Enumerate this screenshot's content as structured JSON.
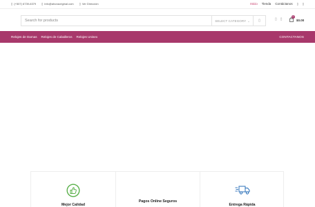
{
  "topbar": {
    "phone": "(+507) 6739-6379",
    "email": "info@ahoraoriginal.com",
    "address": "Ver Dirección",
    "links": {
      "home": "Inicio",
      "shop": "Tienda",
      "contact": "Contáctanos"
    }
  },
  "search": {
    "placeholder": "Search for products",
    "category_label": "SELECT CATEGORY"
  },
  "cart": {
    "count": "0",
    "amount": "$0.00"
  },
  "nav": {
    "items": [
      "Relojes de Damas",
      "Relojes de Caballeros",
      "Relojes Unisex"
    ],
    "contact": "CONTACTANOS"
  },
  "features": [
    {
      "label": "Mejor Calidad",
      "icon": "thumbs-up-icon"
    },
    {
      "label": "Pagos Online Seguros",
      "icon": ""
    },
    {
      "label": "Entrega Rápida",
      "icon": "delivery-truck-icon"
    }
  ],
  "colors": {
    "brand": "#a8386b",
    "active_link": "#c0285c",
    "icon_green": "#5ab04a",
    "icon_blue": "#2a6fb8"
  }
}
